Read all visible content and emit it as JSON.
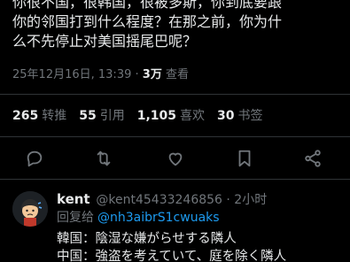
{
  "tweet": {
    "body": "你很不国，很韩国，很被多斯，你到底要跟\n你的邻国打到什么程度？在那之前，你为什\n么不先停止对美国摇尾巴呢？",
    "timestamp": "25年12月16日, 13:39",
    "separator": "·",
    "views_count": "3万",
    "views_label": "查看"
  },
  "stats": [
    {
      "num": "265",
      "label": "转推"
    },
    {
      "num": "55",
      "label": "引用"
    },
    {
      "num": "1,105",
      "label": "喜欢"
    },
    {
      "num": "30",
      "label": "书签"
    }
  ],
  "actions": [
    "reply-icon",
    "retweet-icon",
    "like-icon",
    "bookmark-icon",
    "share-icon"
  ],
  "reply": {
    "name": "kent",
    "handle": "@kent45433246856 · 2小时",
    "reply_to_label": "回复给",
    "reply_to_handle": "@nh3aibrS1cwuaks",
    "lines": [
      "韓国：陰湿な嫌がらせする隣人",
      "中国：強盗を考えていて、庭を除く隣人"
    ]
  },
  "colors": {
    "background": "#000000",
    "text": "#e7e9ea",
    "muted": "#71767b",
    "link": "#1d9bf0",
    "divider": "#2f3336"
  }
}
